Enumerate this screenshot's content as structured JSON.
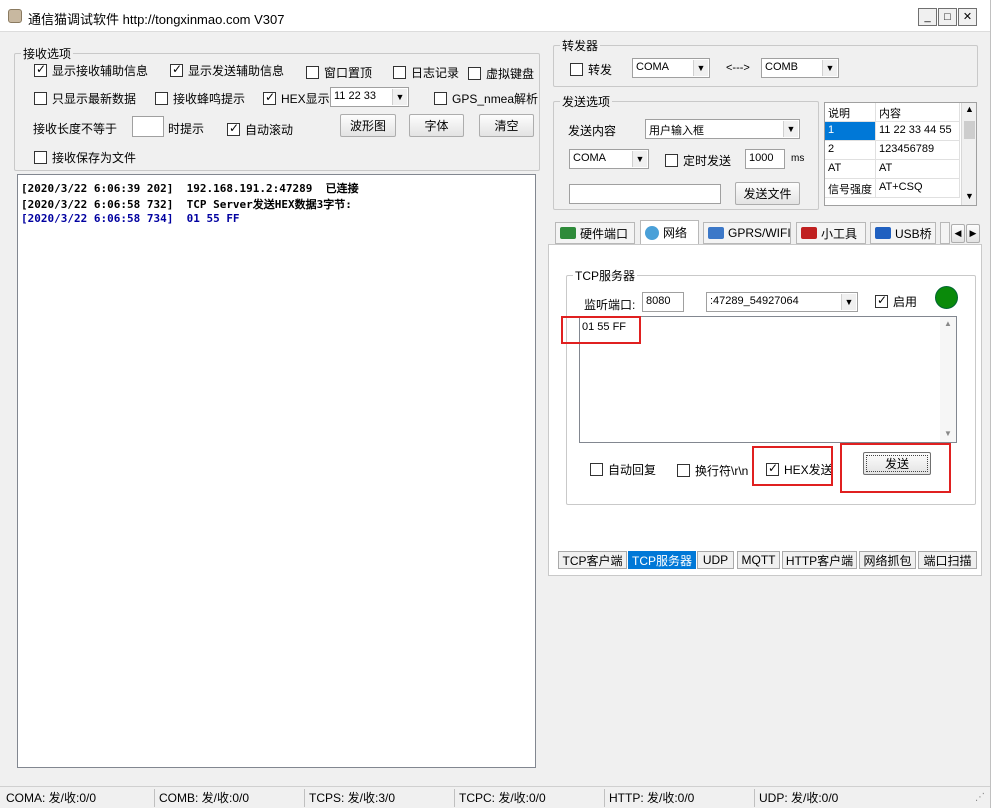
{
  "window": {
    "title": "通信猫调试软件  http://tongxinmao.com  V307",
    "min_label": "_",
    "max_label": "□",
    "close_label": "✕"
  },
  "recv_options": {
    "legend": "接收选项",
    "show_recv_aux": {
      "label": "显示接收辅助信息",
      "checked": true
    },
    "show_send_aux": {
      "label": "显示发送辅助信息",
      "checked": true
    },
    "window_top": {
      "label": "窗口置顶",
      "checked": false
    },
    "log_record": {
      "label": "日志记录",
      "checked": false
    },
    "virtual_keyboard": {
      "label": "虚拟键盘",
      "checked": false
    },
    "latest_only": {
      "label": "只显示最新数据",
      "checked": false
    },
    "beep": {
      "label": "接收蜂鸣提示",
      "checked": false
    },
    "hex_display": {
      "label": "HEX显示",
      "checked": true
    },
    "hex_sample": "11 22 33",
    "gps": {
      "label": "GPS_nmea解析",
      "checked": false
    },
    "length_label": "接收长度不等于",
    "length_value": "",
    "prompt_label": "时提示",
    "auto_scroll": {
      "label": "自动滚动",
      "checked": true
    },
    "waveform_btn": "波形图",
    "font_btn": "字体",
    "clear_btn": "清空",
    "save_file": {
      "label": "接收保存为文件",
      "checked": false
    }
  },
  "log": [
    {
      "time": "[2020/3/22 6:06:39 202]",
      "text": "192.168.191.2:47289  已连接",
      "color": "#000000"
    },
    {
      "time": "[2020/3/22 6:06:58 732]",
      "text": "TCP Server发送HEX数据3字节:",
      "color": "#000000"
    },
    {
      "time": "[2020/3/22 6:06:58 734]",
      "text": "01 55 FF",
      "color": "#0000a0"
    }
  ],
  "forwarder": {
    "legend": "转发器",
    "forward": {
      "label": "转发",
      "checked": false
    },
    "port_a": "COMA",
    "arrow": "<--->",
    "port_b": "COMB"
  },
  "send_options": {
    "legend": "发送选项",
    "content_label": "发送内容",
    "content_value": "用户输入框",
    "port": "COMA",
    "timed_send": {
      "label": "定时发送",
      "checked": false
    },
    "interval": "1000",
    "interval_unit": "ms",
    "file_path": "",
    "send_file_btn": "发送文件"
  },
  "cmd_table": {
    "headers": [
      "说明",
      "内容"
    ],
    "rows": [
      [
        "1",
        "11 22 33 44 55"
      ],
      [
        "2",
        "123456789"
      ],
      [
        "AT",
        "AT"
      ],
      [
        "信号强度",
        "AT+CSQ"
      ]
    ]
  },
  "top_tabs": [
    {
      "label": "硬件端口",
      "icon": "hardware-port-icon",
      "color": "#2e8b3a"
    },
    {
      "label": "网络",
      "icon": "network-icon",
      "color": "#4aa0d8"
    },
    {
      "label": "GPRS/WIFI",
      "icon": "gprs-icon",
      "color": "#3c78c8"
    },
    {
      "label": "小工具",
      "icon": "toolbox-icon",
      "color": "#c02020"
    },
    {
      "label": "USB桥",
      "icon": "usb-bridge-icon",
      "color": "#2060c0"
    }
  ],
  "tcp_server": {
    "legend": "TCP服务器",
    "port_label": "监听端口:",
    "port_value": "8080",
    "client": ":47289_54927064",
    "enable": {
      "label": "启用",
      "checked": true
    },
    "status_color": "#0a8a0a",
    "send_text": "01 55 FF",
    "auto_reply": {
      "label": "自动回复",
      "checked": false
    },
    "newline": {
      "label": "换行符\\r\\n",
      "checked": false
    },
    "hex_send": {
      "label": "HEX发送",
      "checked": true
    },
    "send_btn": "发送"
  },
  "bottom_tabs": [
    {
      "label": "TCP客户端",
      "selected": false
    },
    {
      "label": "TCP服务器",
      "selected": true
    },
    {
      "label": "UDP",
      "selected": false
    },
    {
      "label": "MQTT",
      "selected": false
    },
    {
      "label": "HTTP客户端",
      "selected": false
    },
    {
      "label": "网络抓包",
      "selected": false
    },
    {
      "label": "端口扫描",
      "selected": false
    }
  ],
  "status": [
    "COMA: 发/收:0/0",
    "COMB: 发/收:0/0",
    "TCPS: 发/收:3/0",
    "TCPC: 发/收:0/0",
    "HTTP: 发/收:0/0",
    "UDP: 发/收:0/0"
  ],
  "accent_color": "#0078d7",
  "highlight_color": "#e02020"
}
